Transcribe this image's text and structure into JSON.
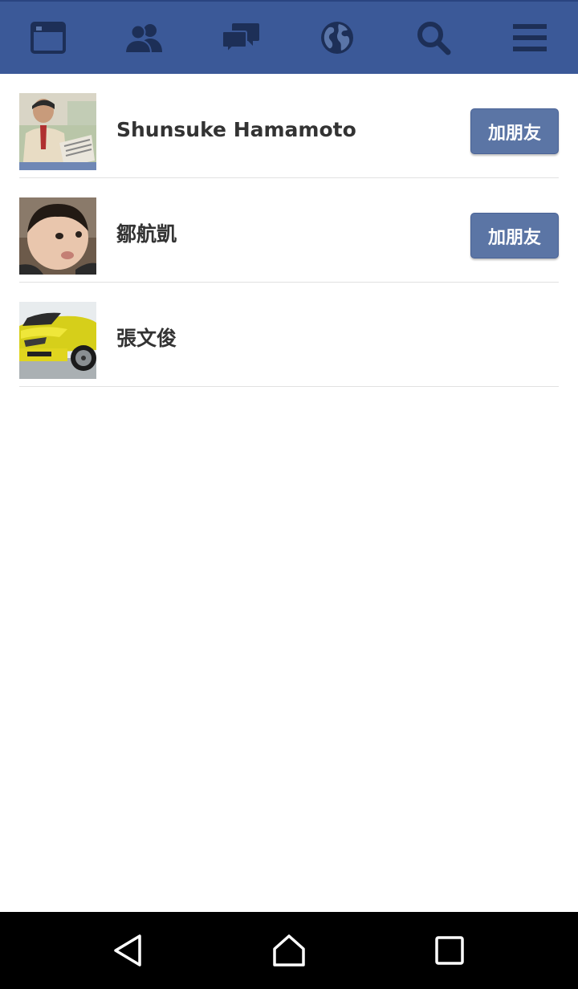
{
  "topbar": {
    "background": "#3b5998",
    "icon_color": "#1d2f57",
    "items": [
      {
        "icon": "news-feed-icon"
      },
      {
        "icon": "friend-requests-icon"
      },
      {
        "icon": "messages-icon"
      },
      {
        "icon": "notifications-globe-icon"
      },
      {
        "icon": "search-icon"
      },
      {
        "icon": "menu-icon"
      }
    ]
  },
  "friends": [
    {
      "name": "Shunsuke Hamamoto",
      "avatar": "man-reading-newspaper",
      "button": "加朋友"
    },
    {
      "name": "鄒航凱",
      "avatar": "toddler-portrait",
      "button": "加朋友"
    },
    {
      "name": "張文俊",
      "avatar": "yellow-sports-car"
    }
  ],
  "accent": {
    "add_button": "#5b75a5"
  },
  "system_nav": {
    "items": [
      {
        "icon": "back-icon"
      },
      {
        "icon": "home-icon"
      },
      {
        "icon": "recent-apps-icon"
      }
    ]
  }
}
